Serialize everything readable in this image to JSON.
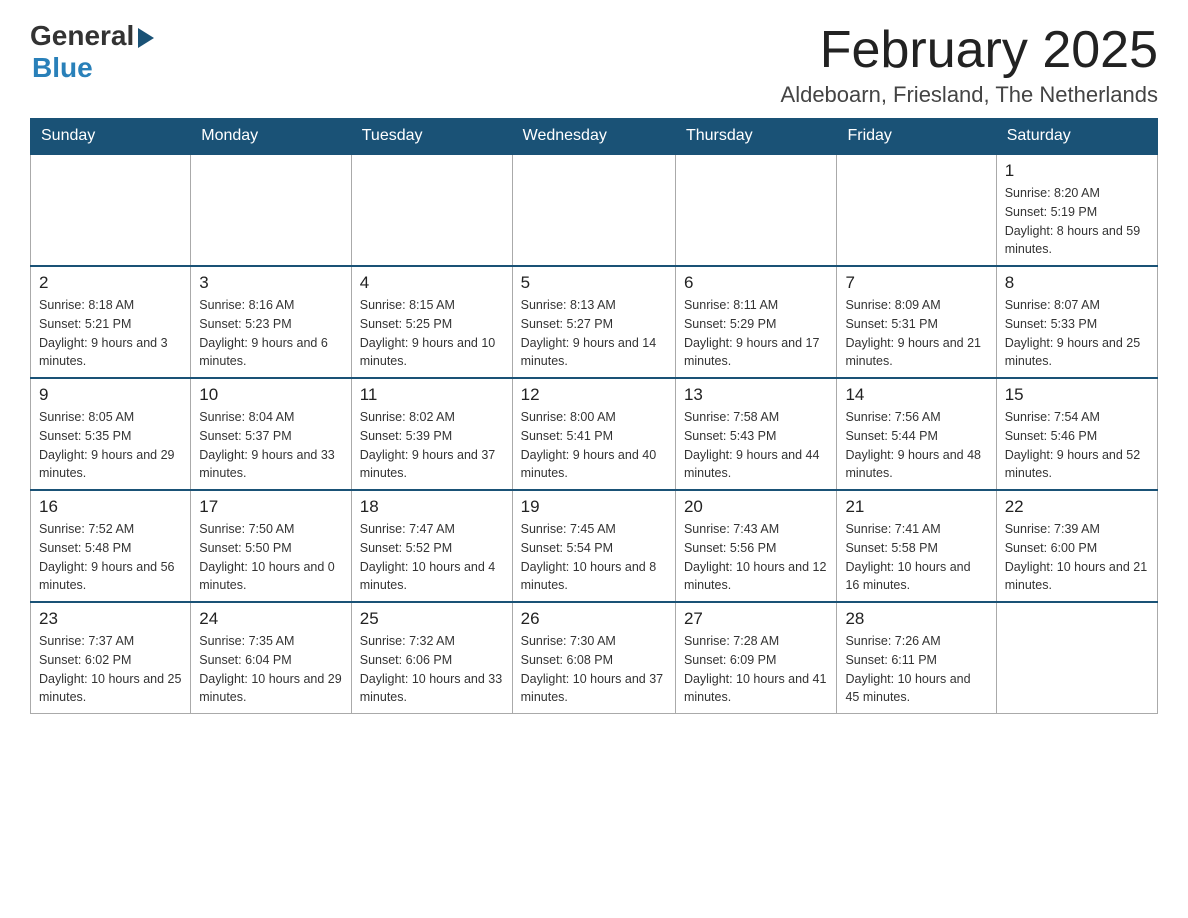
{
  "logo": {
    "general": "General",
    "blue": "Blue"
  },
  "title": {
    "month_year": "February 2025",
    "location": "Aldeboarn, Friesland, The Netherlands"
  },
  "weekdays": [
    "Sunday",
    "Monday",
    "Tuesday",
    "Wednesday",
    "Thursday",
    "Friday",
    "Saturday"
  ],
  "weeks": [
    [
      {
        "day": "",
        "info": ""
      },
      {
        "day": "",
        "info": ""
      },
      {
        "day": "",
        "info": ""
      },
      {
        "day": "",
        "info": ""
      },
      {
        "day": "",
        "info": ""
      },
      {
        "day": "",
        "info": ""
      },
      {
        "day": "1",
        "info": "Sunrise: 8:20 AM\nSunset: 5:19 PM\nDaylight: 8 hours and 59 minutes."
      }
    ],
    [
      {
        "day": "2",
        "info": "Sunrise: 8:18 AM\nSunset: 5:21 PM\nDaylight: 9 hours and 3 minutes."
      },
      {
        "day": "3",
        "info": "Sunrise: 8:16 AM\nSunset: 5:23 PM\nDaylight: 9 hours and 6 minutes."
      },
      {
        "day": "4",
        "info": "Sunrise: 8:15 AM\nSunset: 5:25 PM\nDaylight: 9 hours and 10 minutes."
      },
      {
        "day": "5",
        "info": "Sunrise: 8:13 AM\nSunset: 5:27 PM\nDaylight: 9 hours and 14 minutes."
      },
      {
        "day": "6",
        "info": "Sunrise: 8:11 AM\nSunset: 5:29 PM\nDaylight: 9 hours and 17 minutes."
      },
      {
        "day": "7",
        "info": "Sunrise: 8:09 AM\nSunset: 5:31 PM\nDaylight: 9 hours and 21 minutes."
      },
      {
        "day": "8",
        "info": "Sunrise: 8:07 AM\nSunset: 5:33 PM\nDaylight: 9 hours and 25 minutes."
      }
    ],
    [
      {
        "day": "9",
        "info": "Sunrise: 8:05 AM\nSunset: 5:35 PM\nDaylight: 9 hours and 29 minutes."
      },
      {
        "day": "10",
        "info": "Sunrise: 8:04 AM\nSunset: 5:37 PM\nDaylight: 9 hours and 33 minutes."
      },
      {
        "day": "11",
        "info": "Sunrise: 8:02 AM\nSunset: 5:39 PM\nDaylight: 9 hours and 37 minutes."
      },
      {
        "day": "12",
        "info": "Sunrise: 8:00 AM\nSunset: 5:41 PM\nDaylight: 9 hours and 40 minutes."
      },
      {
        "day": "13",
        "info": "Sunrise: 7:58 AM\nSunset: 5:43 PM\nDaylight: 9 hours and 44 minutes."
      },
      {
        "day": "14",
        "info": "Sunrise: 7:56 AM\nSunset: 5:44 PM\nDaylight: 9 hours and 48 minutes."
      },
      {
        "day": "15",
        "info": "Sunrise: 7:54 AM\nSunset: 5:46 PM\nDaylight: 9 hours and 52 minutes."
      }
    ],
    [
      {
        "day": "16",
        "info": "Sunrise: 7:52 AM\nSunset: 5:48 PM\nDaylight: 9 hours and 56 minutes."
      },
      {
        "day": "17",
        "info": "Sunrise: 7:50 AM\nSunset: 5:50 PM\nDaylight: 10 hours and 0 minutes."
      },
      {
        "day": "18",
        "info": "Sunrise: 7:47 AM\nSunset: 5:52 PM\nDaylight: 10 hours and 4 minutes."
      },
      {
        "day": "19",
        "info": "Sunrise: 7:45 AM\nSunset: 5:54 PM\nDaylight: 10 hours and 8 minutes."
      },
      {
        "day": "20",
        "info": "Sunrise: 7:43 AM\nSunset: 5:56 PM\nDaylight: 10 hours and 12 minutes."
      },
      {
        "day": "21",
        "info": "Sunrise: 7:41 AM\nSunset: 5:58 PM\nDaylight: 10 hours and 16 minutes."
      },
      {
        "day": "22",
        "info": "Sunrise: 7:39 AM\nSunset: 6:00 PM\nDaylight: 10 hours and 21 minutes."
      }
    ],
    [
      {
        "day": "23",
        "info": "Sunrise: 7:37 AM\nSunset: 6:02 PM\nDaylight: 10 hours and 25 minutes."
      },
      {
        "day": "24",
        "info": "Sunrise: 7:35 AM\nSunset: 6:04 PM\nDaylight: 10 hours and 29 minutes."
      },
      {
        "day": "25",
        "info": "Sunrise: 7:32 AM\nSunset: 6:06 PM\nDaylight: 10 hours and 33 minutes."
      },
      {
        "day": "26",
        "info": "Sunrise: 7:30 AM\nSunset: 6:08 PM\nDaylight: 10 hours and 37 minutes."
      },
      {
        "day": "27",
        "info": "Sunrise: 7:28 AM\nSunset: 6:09 PM\nDaylight: 10 hours and 41 minutes."
      },
      {
        "day": "28",
        "info": "Sunrise: 7:26 AM\nSunset: 6:11 PM\nDaylight: 10 hours and 45 minutes."
      },
      {
        "day": "",
        "info": ""
      }
    ]
  ]
}
